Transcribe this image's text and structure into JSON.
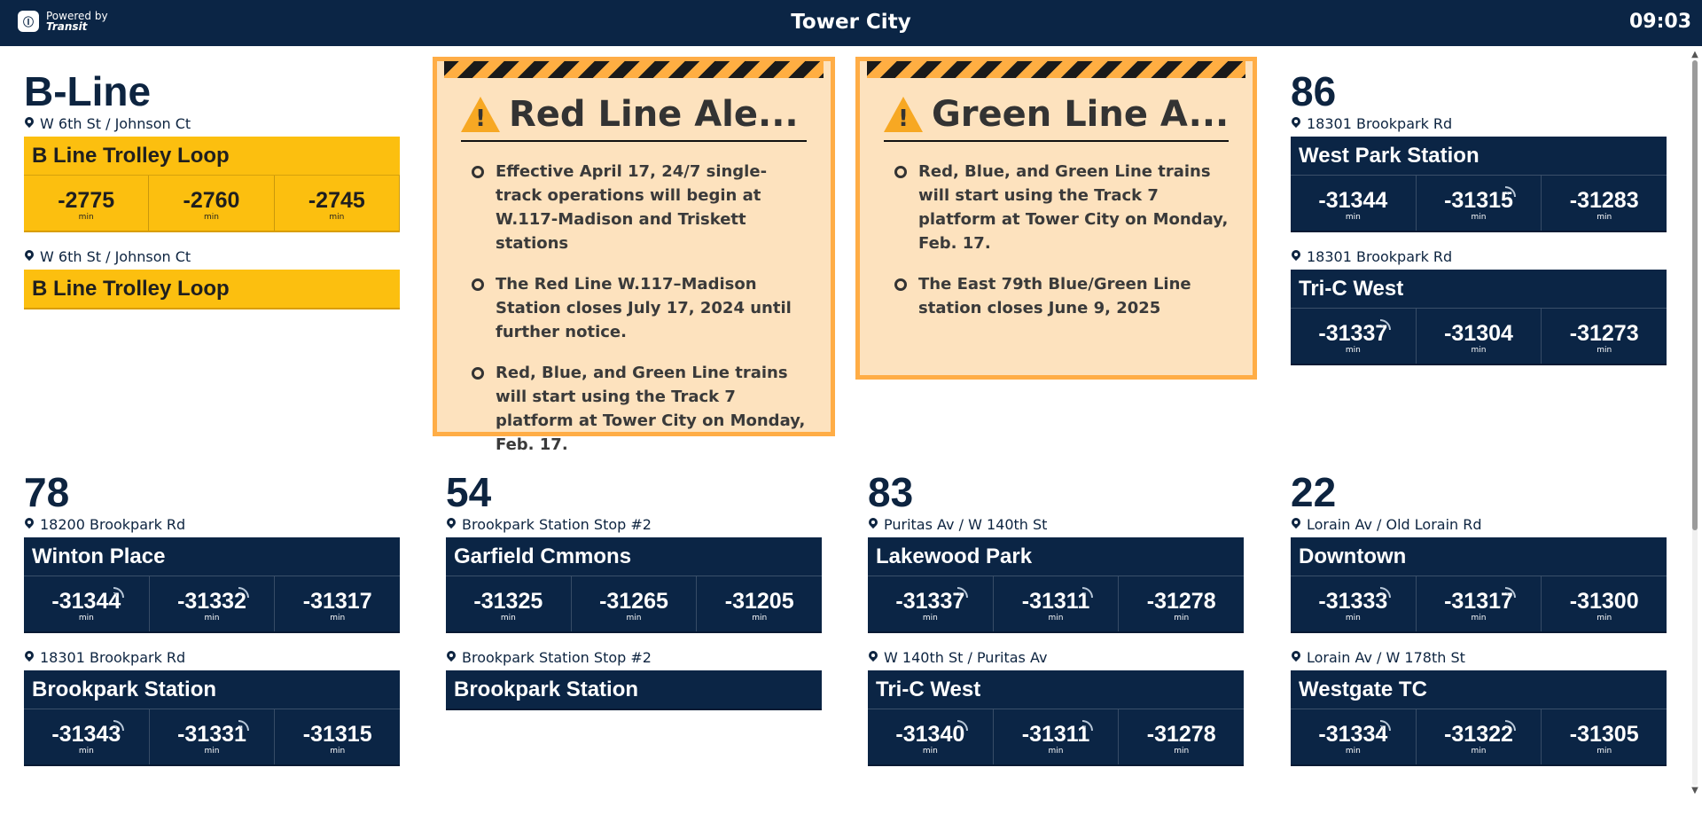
{
  "header": {
    "brand_line1": "Powered by",
    "brand_line2": "Transit",
    "brand_logo_text": "Ⓘ",
    "title": "Tower City",
    "clock": "09:03"
  },
  "time_unit": "min",
  "blocks": [
    {
      "route": "B-Line",
      "directions": [
        {
          "stop": "W 6th St / Johnson Ct",
          "destination": "B Line Trolley Loop",
          "times": [
            "-2775",
            "-2760",
            "-2745"
          ]
        },
        {
          "stop": "W 6th St / Johnson Ct",
          "destination": "B Line Trolley Loop",
          "times": []
        }
      ]
    },
    {
      "route": "86",
      "directions": [
        {
          "stop": "18301 Brookpark Rd",
          "destination": "West Park Station",
          "times": [
            "-31344",
            "-31315",
            "-31283"
          ]
        },
        {
          "stop": "18301 Brookpark Rd",
          "destination": "Tri-C West",
          "times": [
            "-31337",
            "-31304",
            "-31273"
          ]
        }
      ]
    },
    {
      "route": "78",
      "directions": [
        {
          "stop": "18200 Brookpark Rd",
          "destination": "Winton Place",
          "times": [
            "-31344",
            "-31332",
            "-31317"
          ]
        },
        {
          "stop": "18301 Brookpark Rd",
          "destination": "Brookpark Station",
          "times": [
            "-31343",
            "-31331",
            "-31315"
          ]
        }
      ]
    },
    {
      "route": "54",
      "directions": [
        {
          "stop": "Brookpark Station Stop #2",
          "destination": "Garfield Cmmons",
          "times": [
            "-31325",
            "-31265",
            "-31205"
          ]
        },
        {
          "stop": "Brookpark Station Stop #2",
          "destination": "Brookpark Station",
          "times": []
        }
      ]
    },
    {
      "route": "83",
      "directions": [
        {
          "stop": "Puritas Av / W 140th St",
          "destination": "Lakewood Park",
          "times": [
            "-31337",
            "-31311",
            "-31278"
          ]
        },
        {
          "stop": "W 140th St / Puritas Av",
          "destination": "Tri-C West",
          "times": [
            "-31340",
            "-31311",
            "-31278"
          ]
        }
      ]
    },
    {
      "route": "22",
      "directions": [
        {
          "stop": "Lorain Av / Old Lorain Rd",
          "destination": "Downtown",
          "times": [
            "-31333",
            "-31317",
            "-31300"
          ]
        },
        {
          "stop": "Lorain Av / W 178th St",
          "destination": "Westgate TC",
          "times": [
            "-31334",
            "-31322",
            "-31305"
          ]
        }
      ]
    }
  ],
  "alerts": [
    {
      "title": "Red Line Ale...",
      "items": [
        "Effective April 17, 24/7 single-track operations will begin at W.117-Madison and Triskett stations",
        "The Red Line W.117–Madison Station closes July 17, 2024 until further notice.",
        "Red, Blue, and Green Line trains will start using the Track 7 platform at Tower City on Monday, Feb. 17."
      ]
    },
    {
      "title": "Green Line A...",
      "items": [
        "Red, Blue, and Green Line trains will start using the Track 7 platform at Tower City on Monday, Feb. 17.",
        "The East 79th Blue/Green Line station closes June 9, 2025"
      ]
    }
  ],
  "colors": {
    "header_bg": "#0b2545",
    "card_bg": "#0b2545",
    "trolley_yellow": "#fcbf0f",
    "alert_bg": "#fde2be",
    "alert_border": "#ffad46"
  },
  "icons": {
    "stop": "map-pin-icon",
    "realtime": "realtime-signal-icon",
    "alert": "warning-triangle-icon",
    "scroll_up": "scroll-up-arrow-icon",
    "scroll_down": "scroll-down-arrow-icon"
  }
}
